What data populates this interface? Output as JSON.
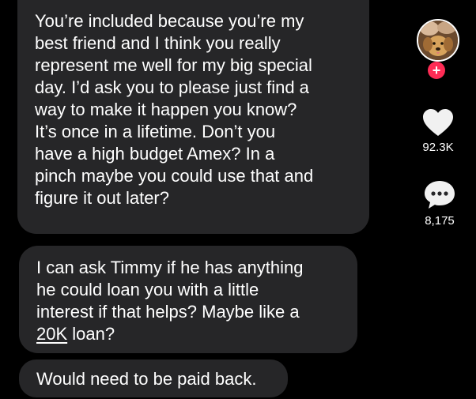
{
  "messages": {
    "first": {
      "lines": [
        "You’re included because you’re my",
        "best friend and I think you really",
        "represent me well for my big special",
        "day. I’d ask you to please just find a",
        "way to make it happen you know?",
        "It’s once in a lifetime. Don’t you",
        "have a high budget Amex? In a",
        "pinch maybe you could use that and",
        "figure it out later?"
      ]
    },
    "second": {
      "lines": [
        "I can ask Timmy if he has anything",
        "he could loan you with a little",
        "interest if that helps? Maybe like a"
      ],
      "last_line_link": "20K",
      "last_line_rest": " loan?"
    },
    "third": {
      "text": "Would need to be paid back."
    }
  },
  "sidebar": {
    "follow_plus": "+",
    "likes_count": "92.3K",
    "comments_count": "8,175",
    "icons": {
      "avatar": "profile-avatar",
      "follow": "follow-plus-icon",
      "like": "heart-icon",
      "comment": "comment-bubble-icon"
    }
  },
  "colors": {
    "background": "#000000",
    "bubble": "#262628",
    "text": "#ffffff",
    "accent": "#fe2c55"
  }
}
